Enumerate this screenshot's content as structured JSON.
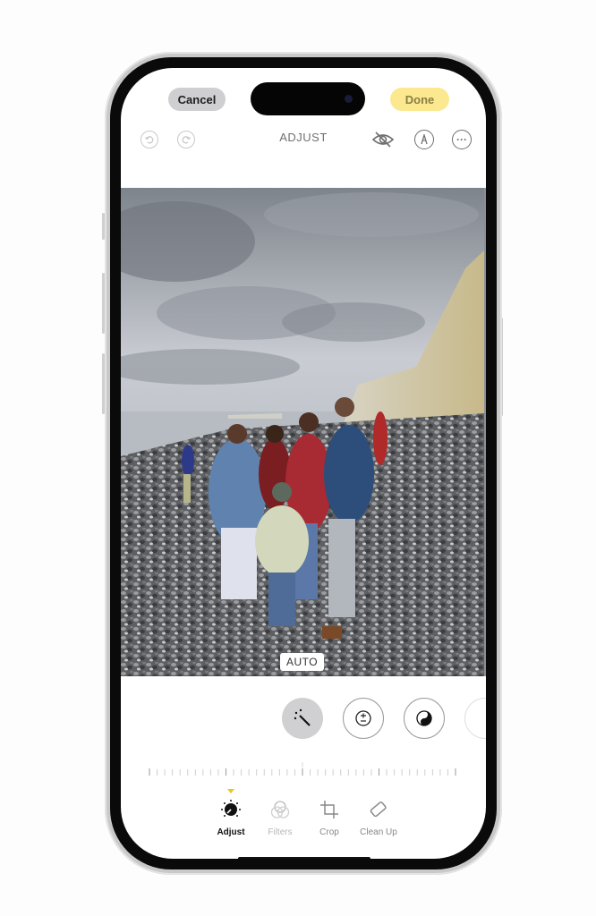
{
  "header": {
    "cancel_label": "Cancel",
    "done_label": "Done",
    "title": "ADJUST"
  },
  "toolbar_icons": [
    "undo-icon",
    "redo-icon",
    "hide-eye-icon",
    "markup-pen-icon",
    "more-ellipsis-icon"
  ],
  "photo": {
    "auto_badge": "AUTO",
    "description": "Family of five posing on a pebble beach beneath white chalk cliffs under a cloudy sky"
  },
  "adjust_tools": [
    {
      "name": "auto-enhance",
      "icon": "magic-wand-icon",
      "selected": true
    },
    {
      "name": "exposure",
      "icon": "exposure-plus-minus-icon",
      "selected": false
    },
    {
      "name": "brilliance",
      "icon": "yin-yang-icon",
      "selected": false
    }
  ],
  "slider": {
    "value": 0.5
  },
  "tabs": [
    {
      "label": "Adjust",
      "icon": "adjust-dial-icon",
      "active": true
    },
    {
      "label": "Filters",
      "icon": "filters-circles-icon",
      "active": false
    },
    {
      "label": "Crop",
      "icon": "crop-rotate-icon",
      "active": false
    },
    {
      "label": "Clean Up",
      "icon": "eraser-icon",
      "active": false
    }
  ],
  "colors": {
    "accent_yellow": "#f0c419",
    "done_bg": "#fbe88f",
    "cancel_bg": "#cfcfd1"
  }
}
